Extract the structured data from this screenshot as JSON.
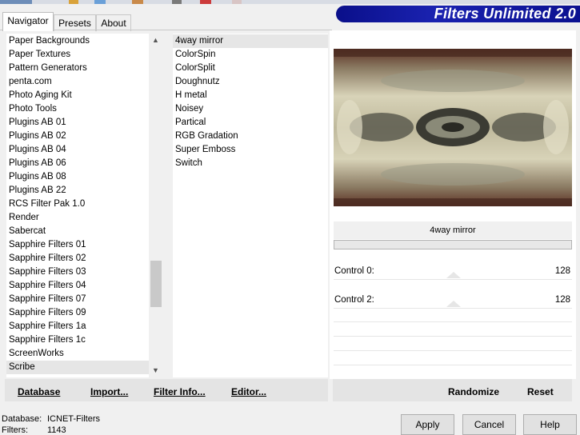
{
  "tabs": [
    {
      "label": "Navigator",
      "active": true
    },
    {
      "label": "Presets",
      "active": false
    },
    {
      "label": "About",
      "active": false
    }
  ],
  "banner": {
    "title": "Filters Unlimited 2.0"
  },
  "categories": {
    "items": [
      "Paper Backgrounds",
      "Paper Textures",
      "Pattern Generators",
      "penta.com",
      "Photo Aging Kit",
      "Photo Tools",
      "Plugins AB 01",
      "Plugins AB 02",
      "Plugins AB 04",
      "Plugins AB 06",
      "Plugins AB 08",
      "Plugins AB 22",
      "RCS Filter Pak 1.0",
      "Render",
      "Sabercat",
      "Sapphire Filters 01",
      "Sapphire Filters 02",
      "Sapphire Filters 03",
      "Sapphire Filters 04",
      "Sapphire Filters 07",
      "Sapphire Filters 09",
      "Sapphire Filters 1a",
      "Sapphire Filters 1c",
      "ScreenWorks",
      "Scribe"
    ],
    "selected": "Scribe"
  },
  "filters": {
    "items": [
      "4way mirror",
      "ColorSpin",
      "ColorSplit",
      "Doughnutz",
      "H metal",
      "Noisey",
      "Partical",
      "RGB Gradation",
      "Super Emboss",
      "Switch"
    ],
    "selected": "4way mirror"
  },
  "left_buttons": {
    "database": "Database",
    "import": "Import...",
    "filter_info": "Filter Info...",
    "editor": "Editor..."
  },
  "preview": {
    "filter_name": "4way mirror",
    "progress": 0
  },
  "controls": [
    {
      "label": "Control 0:",
      "value": "128",
      "level": 128,
      "max": 255
    },
    {
      "label": "Control 2:",
      "value": "128",
      "level": 128,
      "max": 255
    }
  ],
  "right_buttons": {
    "randomize": "Randomize",
    "reset": "Reset"
  },
  "footer": {
    "database_label": "Database:",
    "database_value": "ICNET-Filters",
    "filters_label": "Filters:",
    "filters_value": "1143"
  },
  "dialog_buttons": {
    "apply": "Apply",
    "cancel": "Cancel",
    "help": "Help"
  },
  "colors": {
    "banner": "#1a22b0",
    "selection": "#e6e6e6"
  }
}
